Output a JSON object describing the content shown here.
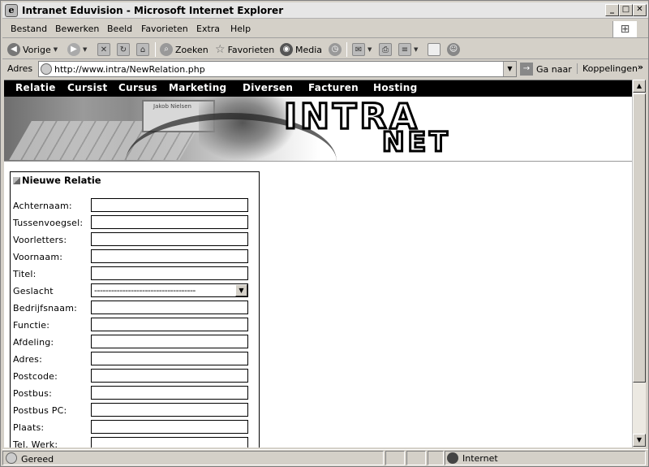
{
  "window": {
    "title": "Intranet Eduvision - Microsoft Internet Explorer"
  },
  "menubar": {
    "items": [
      "Bestand",
      "Bewerken",
      "Beeld",
      "Favorieten",
      "Extra",
      "Help"
    ]
  },
  "toolbar": {
    "back": "Vorige",
    "search": "Zoeken",
    "favorites": "Favorieten",
    "media": "Media"
  },
  "addressbar": {
    "label": "Adres",
    "url": "http://www.intra/NewRelation.php",
    "go": "Ga naar",
    "links": "Koppelingen"
  },
  "site": {
    "nav": [
      "Relatie",
      "Cursist",
      "Cursus",
      "Marketing",
      "Diversen",
      "Facturen",
      "Hosting"
    ],
    "banner": {
      "logo_line1": "INTRA",
      "logo_line2": "NET",
      "screen_text": "Jakob Nielsen"
    }
  },
  "form": {
    "title": "Nieuwe Relatie",
    "fields": [
      {
        "label": "Achternaam:",
        "value": ""
      },
      {
        "label": "Tussenvoegsel:",
        "value": ""
      },
      {
        "label": "Voorletters:",
        "value": ""
      },
      {
        "label": "Voornaam:",
        "value": ""
      },
      {
        "label": "Titel:",
        "value": ""
      },
      {
        "label": "Geslacht",
        "value": "------------------------------------"
      },
      {
        "label": "Bedrijfsnaam:",
        "value": ""
      },
      {
        "label": "Functie:",
        "value": ""
      },
      {
        "label": "Afdeling:",
        "value": ""
      },
      {
        "label": "Adres:",
        "value": ""
      },
      {
        "label": "Postcode:",
        "value": ""
      },
      {
        "label": "Postbus:",
        "value": ""
      },
      {
        "label": "Postbus PC:",
        "value": ""
      },
      {
        "label": "Plaats:",
        "value": ""
      },
      {
        "label": "Tel. Werk:",
        "value": ""
      }
    ]
  },
  "statusbar": {
    "text": "Gereed",
    "zone": "Internet"
  }
}
